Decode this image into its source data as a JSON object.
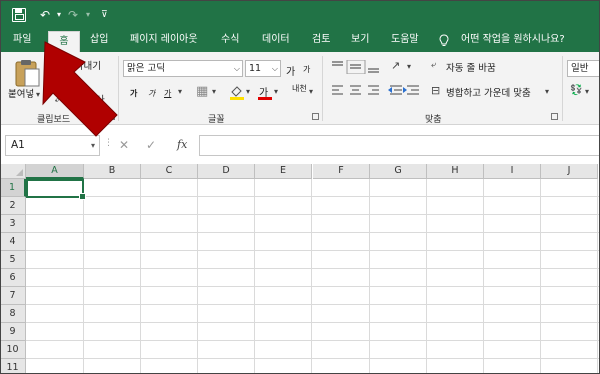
{
  "colors": {
    "accent": "#217346",
    "ribbon_bg": "#f3f3f3",
    "annotation_arrow": "#b00000"
  },
  "quick_access": {
    "icons": [
      "save-icon",
      "undo-icon",
      "redo-icon",
      "customize-icon"
    ]
  },
  "tabs": [
    {
      "label": "파일"
    },
    {
      "label": "홈"
    },
    {
      "label": "삽입"
    },
    {
      "label": "페이지 레이아웃"
    },
    {
      "label": "수식"
    },
    {
      "label": "데이터"
    },
    {
      "label": "검토"
    },
    {
      "label": "보기"
    },
    {
      "label": "도움말"
    }
  ],
  "tell_me": "어떤 작업을 원하시나요?",
  "ribbon": {
    "clipboard": {
      "label": "클립보드",
      "paste": "붙여넣",
      "cut": "잘라내기",
      "copy": "사"
    },
    "font": {
      "label": "글꼴",
      "font_name": "맑은 고딕",
      "font_size": "11",
      "grow": "가",
      "shrink": "가",
      "bold": "가",
      "italic": "가",
      "underline": "가",
      "font_color_glyph": "가",
      "phonetic": "내천"
    },
    "alignment": {
      "label": "맞춤",
      "wrap_text": "자동 줄 바꿈",
      "merge_center": "병합하고 가운데 맞춤"
    },
    "number": {
      "format": "일반"
    }
  },
  "formula_bar": {
    "name_box": "A1",
    "fx": "fx",
    "formula": ""
  },
  "sheet": {
    "columns": [
      "A",
      "B",
      "C",
      "D",
      "E",
      "F",
      "G",
      "H",
      "I",
      "J"
    ],
    "rows": [
      "1",
      "2",
      "3",
      "4",
      "5",
      "6",
      "7",
      "8",
      "9",
      "10",
      "11"
    ],
    "active_cell": "A1"
  }
}
